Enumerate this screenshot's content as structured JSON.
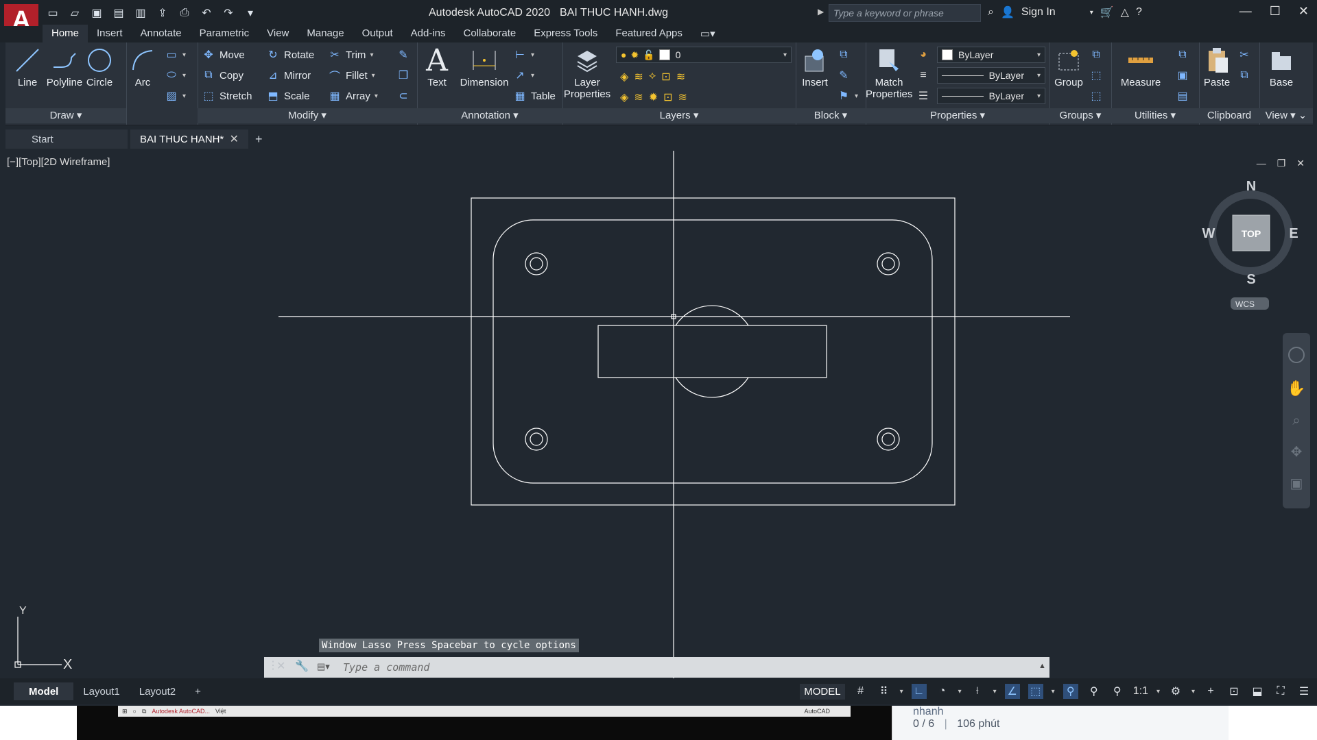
{
  "app": {
    "title": "Autodesk AutoCAD 2020",
    "filename": "BAI THUC HANH.dwg",
    "search_placeholder": "Type a keyword or phrase",
    "sign_in": "Sign In",
    "logo_letter": "A"
  },
  "ribbon_tabs": [
    "Home",
    "Insert",
    "Annotate",
    "Parametric",
    "View",
    "Manage",
    "Output",
    "Add-ins",
    "Collaborate",
    "Express Tools",
    "Featured Apps"
  ],
  "draw_panel": {
    "title": "Draw",
    "line": "Line",
    "polyline": "Polyline",
    "circle": "Circle",
    "arc": "Arc"
  },
  "modify_panel": {
    "title": "Modify",
    "move": "Move",
    "rotate": "Rotate",
    "trim": "Trim",
    "copy": "Copy",
    "mirror": "Mirror",
    "fillet": "Fillet",
    "stretch": "Stretch",
    "scale": "Scale",
    "array": "Array"
  },
  "annotation_panel": {
    "title": "Annotation",
    "text": "Text",
    "dimension": "Dimension",
    "table": "Table"
  },
  "layers_panel": {
    "title": "Layers",
    "layer_properties_1": "Layer",
    "layer_properties_2": "Properties",
    "current_layer": "0"
  },
  "block_panel": {
    "title": "Block",
    "insert": "Insert"
  },
  "properties_panel": {
    "title": "Properties",
    "match_1": "Match",
    "match_2": "Properties",
    "color": "ByLayer",
    "linetype": "ByLayer",
    "lineweight": "ByLayer"
  },
  "groups_panel": {
    "title": "Groups",
    "group": "Group"
  },
  "utilities_panel": {
    "title": "Utilities",
    "measure": "Measure"
  },
  "clipboard_panel": {
    "title": "Clipboard",
    "paste": "Paste"
  },
  "view_panel": {
    "title": "View",
    "base": "Base"
  },
  "doc_tabs": {
    "start": "Start",
    "active": "BAI THUC HANH*"
  },
  "viewport": {
    "label": "[−][Top][2D Wireframe]",
    "viewcube_top": "TOP",
    "compass_n": "N",
    "compass_s": "S",
    "compass_e": "E",
    "compass_w": "W",
    "wcs": "WCS",
    "ucs_y": "Y",
    "ucs_x": "X"
  },
  "command": {
    "message": "Window Lasso  Press Spacebar to cycle options",
    "placeholder": "Type a command"
  },
  "layout_tabs": [
    "Model",
    "Layout1",
    "Layout2"
  ],
  "status": {
    "model": "MODEL",
    "scale": "1:1"
  },
  "side_card": {
    "name": "nhanh",
    "progress": "0 / 6",
    "time": "106 phút"
  },
  "taskbar_items": [
    "Autodesk AutoCAD...",
    "Việt",
    "AutoCAD"
  ],
  "colors": {
    "canvas": "#212830",
    "ribbon": "#2b323b",
    "logo": "#b2202a",
    "lines": "#ffffff"
  }
}
